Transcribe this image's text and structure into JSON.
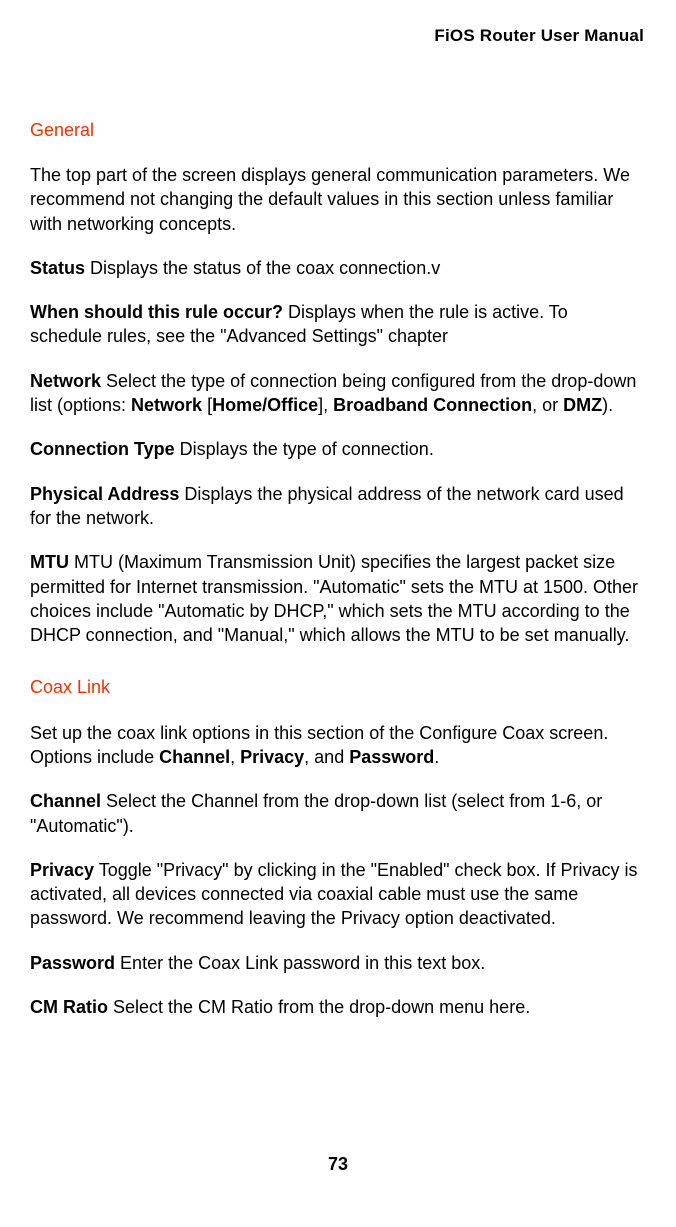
{
  "header": {
    "title": "FiOS Router User Manual"
  },
  "sections": {
    "general": {
      "heading": "General",
      "intro": "The top part of the screen displays general communication parameters. We recommend not changing the default values in this section unless familiar with networking concepts.",
      "status_label": "Status",
      "status_text": "  Displays the status of the coax connection.v",
      "when_label": "When should this rule occur?",
      "when_text": "  Displays when the rule is active. To schedule rules, see the \"Advanced Settings\" chapter",
      "network_label": "Network",
      "network_text_1": "  Select the type of connection being configured from the drop-down list (options: ",
      "network_bold_1": "Network",
      "network_text_2": " [",
      "network_bold_2": "Home/Office",
      "network_text_3": "], ",
      "network_bold_3": "Broadband Connection",
      "network_text_4": ", or ",
      "network_bold_4": "DMZ",
      "network_text_5": ").",
      "conn_label": "Connection Type",
      "conn_text": "  Displays the type of connection.",
      "phys_label": "Physical Address",
      "phys_text": "  Displays the physical address of the network card used for the network.",
      "mtu_label": "MTU",
      "mtu_text": "  MTU (Maximum Transmission Unit) specifies the largest packet size permitted for Internet transmission. \"Automatic\" sets the MTU at 1500. Other choices include \"Automatic by DHCP,\" which sets the MTU according to the DHCP connection, and \"Manual,\" which allows the MTU to be set manually."
    },
    "coax": {
      "heading": "Coax Link",
      "intro_1": "Set up the coax link options in this section of the Configure Coax screen. Options include ",
      "intro_bold_1": "Channel",
      "intro_2": ", ",
      "intro_bold_2": "Privacy",
      "intro_3": ", and ",
      "intro_bold_3": "Password",
      "intro_4": ".",
      "channel_label": "Channel",
      "channel_text": "  Select the Channel from the drop-down list (select from 1-6, or \"Automatic\").",
      "privacy_label": "Privacy",
      "privacy_text": "  Toggle \"Privacy\" by clicking in the \"Enabled\" check box. If Privacy is activated, all devices connected via coaxial cable must use the same password. We recommend leaving the Privacy option deactivated.",
      "password_label": "Password",
      "password_text": "  Enter the Coax Link password in this text box.",
      "cm_label": "CM Ratio",
      "cm_text": "  Select the CM Ratio from the drop-down menu here."
    }
  },
  "page_number": "73"
}
